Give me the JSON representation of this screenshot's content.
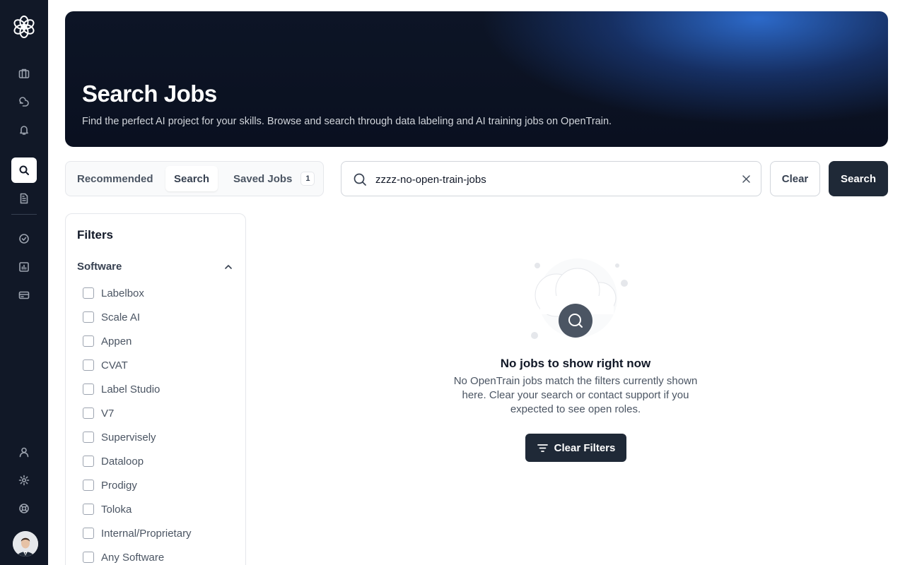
{
  "sidebar": {
    "logo_icon": "openai-flower-icon",
    "items": [
      {
        "icon": "briefcase-icon"
      },
      {
        "icon": "chat-bubbles-icon"
      },
      {
        "icon": "bell-icon"
      },
      {
        "icon": "search-icon",
        "active": true
      },
      {
        "icon": "document-icon"
      },
      {
        "icon": "check-circle-icon"
      },
      {
        "icon": "chart-icon"
      },
      {
        "icon": "credit-card-icon"
      },
      {
        "icon": "user-icon"
      },
      {
        "icon": "gear-icon"
      },
      {
        "icon": "lifebuoy-icon"
      }
    ]
  },
  "hero": {
    "title": "Search Jobs",
    "subtitle": "Find the perfect AI project for your skills. Browse and search through data labeling and AI training jobs on OpenTrain."
  },
  "tabs": [
    {
      "label": "Recommended"
    },
    {
      "label": "Search",
      "active": true
    },
    {
      "label": "Saved Jobs",
      "badge": "1"
    }
  ],
  "search": {
    "value": "zzzz-no-open-train-jobs",
    "clear_label": "Clear",
    "search_label": "Search"
  },
  "filters": {
    "title": "Filters",
    "section_title": "Software",
    "options": [
      "Labelbox",
      "Scale AI",
      "Appen",
      "CVAT",
      "Label Studio",
      "V7",
      "Supervisely",
      "Dataloop",
      "Prodigy",
      "Toloka",
      "Internal/Proprietary",
      "Any Software"
    ]
  },
  "empty_state": {
    "title": "No jobs to show right now",
    "message": "No OpenTrain jobs match the filters currently shown here. Clear your search or contact support if you expected to see open roles.",
    "button_label": "Clear Filters"
  },
  "colors": {
    "sidebar_bg": "#111827",
    "primary_button": "#1f2937",
    "hero_accent": "#2e6ed2"
  }
}
